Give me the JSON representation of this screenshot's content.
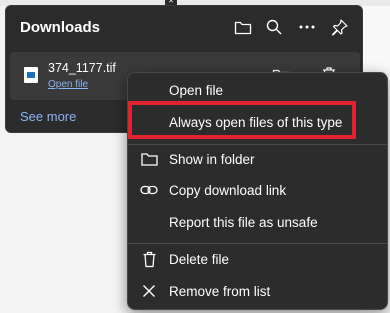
{
  "downloads": {
    "title": "Downloads",
    "file": {
      "name": "374_1177.tif",
      "open_label": "Open file"
    },
    "see_more": "See more"
  },
  "context_menu": {
    "items": [
      {
        "label": "Open file",
        "icon": "none"
      },
      {
        "label": "Always open files of this type",
        "icon": "none"
      },
      {
        "label": "Show in folder",
        "icon": "folder-icon"
      },
      {
        "label": "Copy download link",
        "icon": "link-icon"
      },
      {
        "label": "Report this file as unsafe",
        "icon": "none"
      },
      {
        "label": "Delete file",
        "icon": "trash-icon"
      },
      {
        "label": "Remove from list",
        "icon": "x-icon"
      }
    ]
  },
  "colors": {
    "panel_bg": "#2b2b2b",
    "menu_bg": "#2c2c2c",
    "link": "#8ab4f8",
    "highlight_box": "#e0242f"
  }
}
